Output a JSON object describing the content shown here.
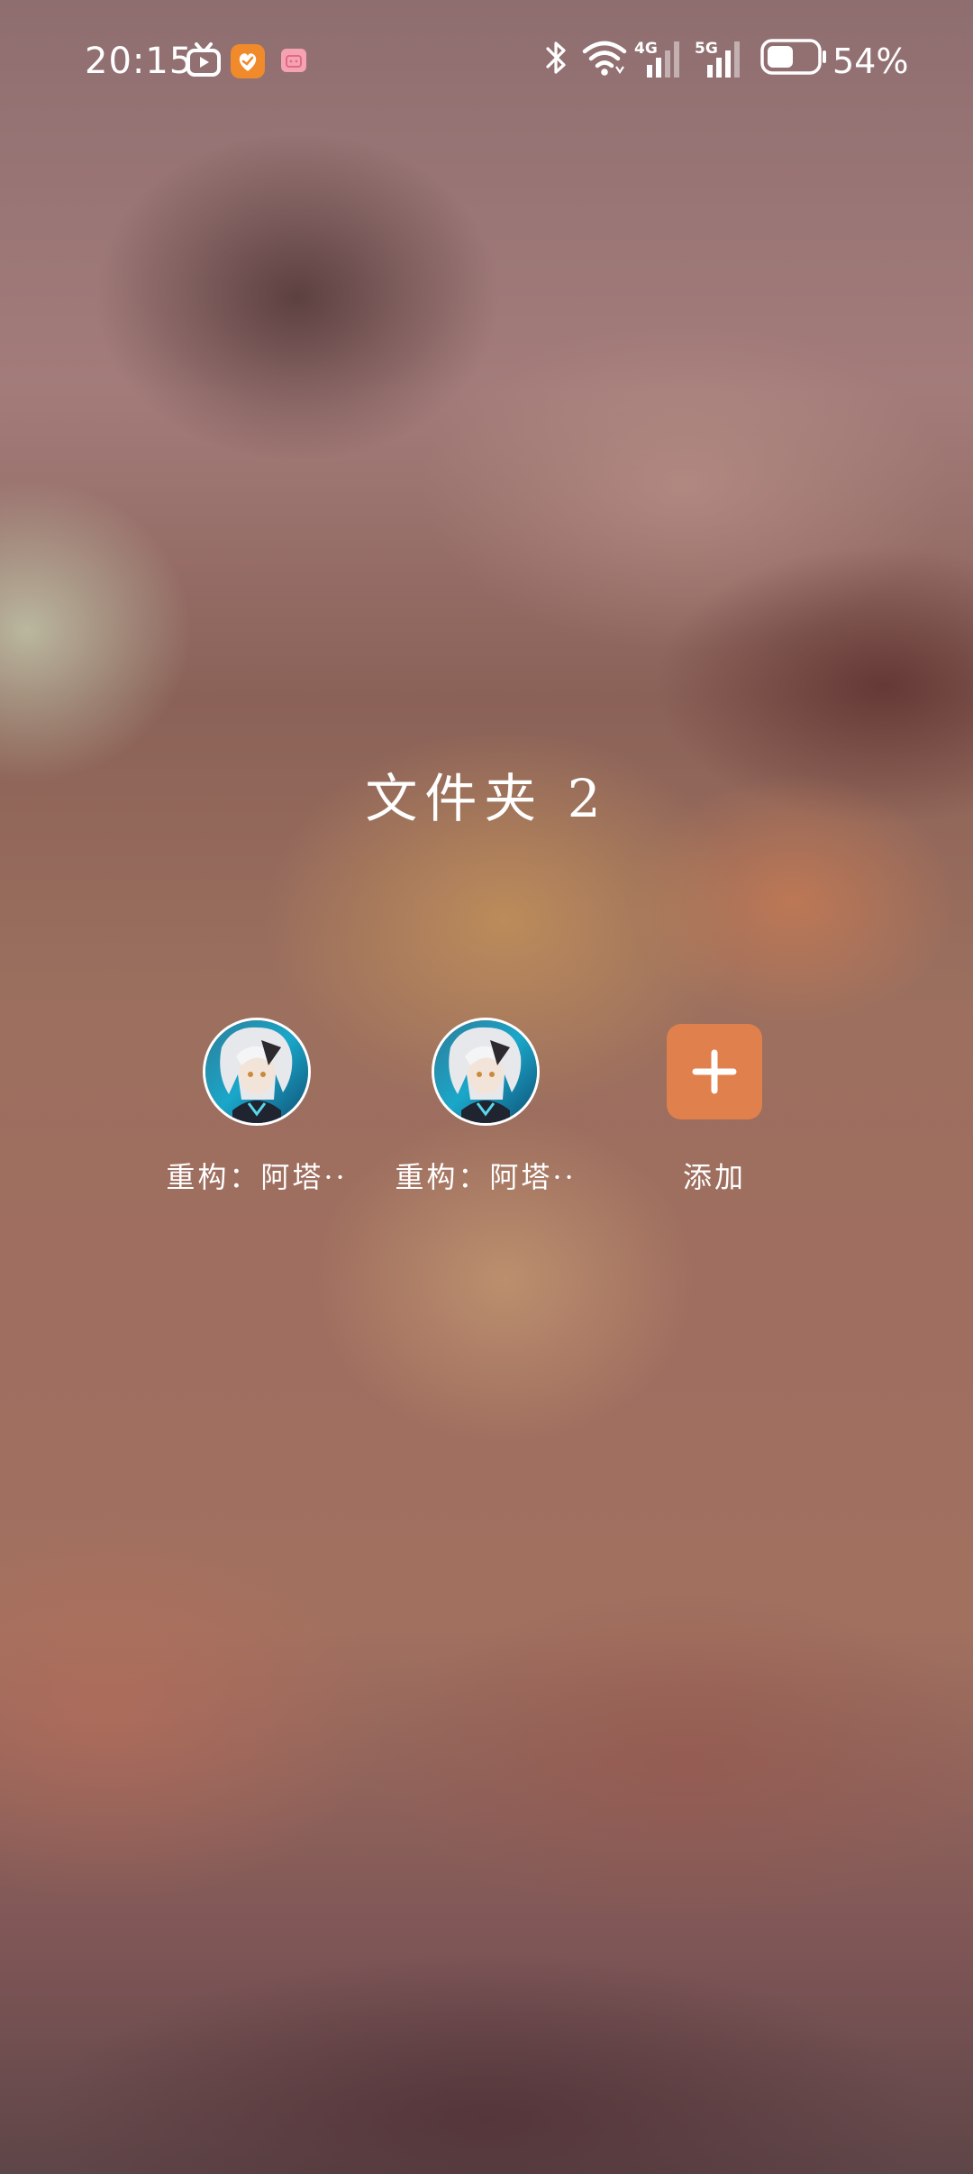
{
  "status_bar": {
    "time": "20:15",
    "battery_percent": "54%",
    "battery_level": 0.54,
    "network_1": "4G",
    "network_2": "5G",
    "icons": [
      "tv-icon",
      "heart-app-icon",
      "bilibili-icon",
      "bluetooth-icon",
      "wifi-icon",
      "signal-4g-icon",
      "signal-5g-icon",
      "battery-icon"
    ]
  },
  "folder": {
    "title": "文件夹 2",
    "apps": [
      {
        "label": "重构：阿塔··",
        "icon": "game-avatar-icon"
      },
      {
        "label": "重构：阿塔··",
        "icon": "game-avatar-icon"
      },
      {
        "label": "添加",
        "icon": "plus-icon"
      }
    ]
  },
  "colors": {
    "add_button": "#e0814d",
    "text": "#ffffff"
  }
}
